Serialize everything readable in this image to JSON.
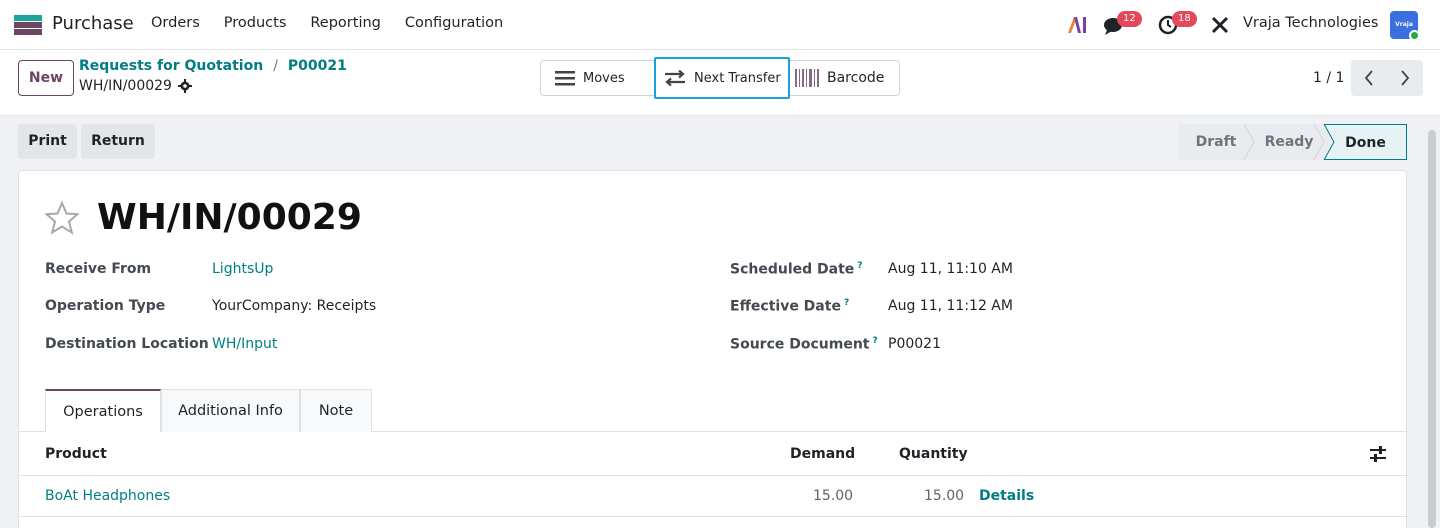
{
  "navbar": {
    "app_name": "Purchase",
    "menu": [
      "Orders",
      "Products",
      "Reporting",
      "Configuration"
    ],
    "chat_count": "12",
    "activity_count": "18",
    "company": "Vraja Technologies",
    "avatar_text": "Vraja",
    "accent": "#6b4561"
  },
  "control": {
    "new_label": "New",
    "breadcrumb": [
      "Requests for Quotation",
      "P00021"
    ],
    "record_name": "WH/IN/00029",
    "smart_buttons": {
      "moves": "Moves",
      "next_transfer": "Next Transfer",
      "barcode": "Barcode"
    },
    "pager": "1 / 1"
  },
  "actions": {
    "print": "Print",
    "return": "Return"
  },
  "status": {
    "steps": [
      "Draft",
      "Ready",
      "Done"
    ],
    "current": "Done"
  },
  "form": {
    "title": "WH/IN/00029",
    "left_fields": [
      {
        "label": "Receive From",
        "value": "LightsUp"
      },
      {
        "label": "Operation Type",
        "value": "YourCompany: Receipts"
      },
      {
        "label": "Destination Location",
        "value": "WH/Input"
      }
    ],
    "right_fields": [
      {
        "label": "Scheduled Date",
        "value": "Aug 11, 11:10 AM"
      },
      {
        "label": "Effective Date",
        "value": "Aug 11, 11:12 AM"
      },
      {
        "label": "Source Document",
        "value": "P00021"
      }
    ],
    "help_mark": "?"
  },
  "tabs": [
    "Operations",
    "Additional Info",
    "Note"
  ],
  "table": {
    "headers": [
      "Product",
      "Demand",
      "Quantity"
    ],
    "rows": [
      {
        "product": "BoAt Headphones",
        "demand": "15.00",
        "quantity": "15.00",
        "details": "Details"
      }
    ]
  }
}
